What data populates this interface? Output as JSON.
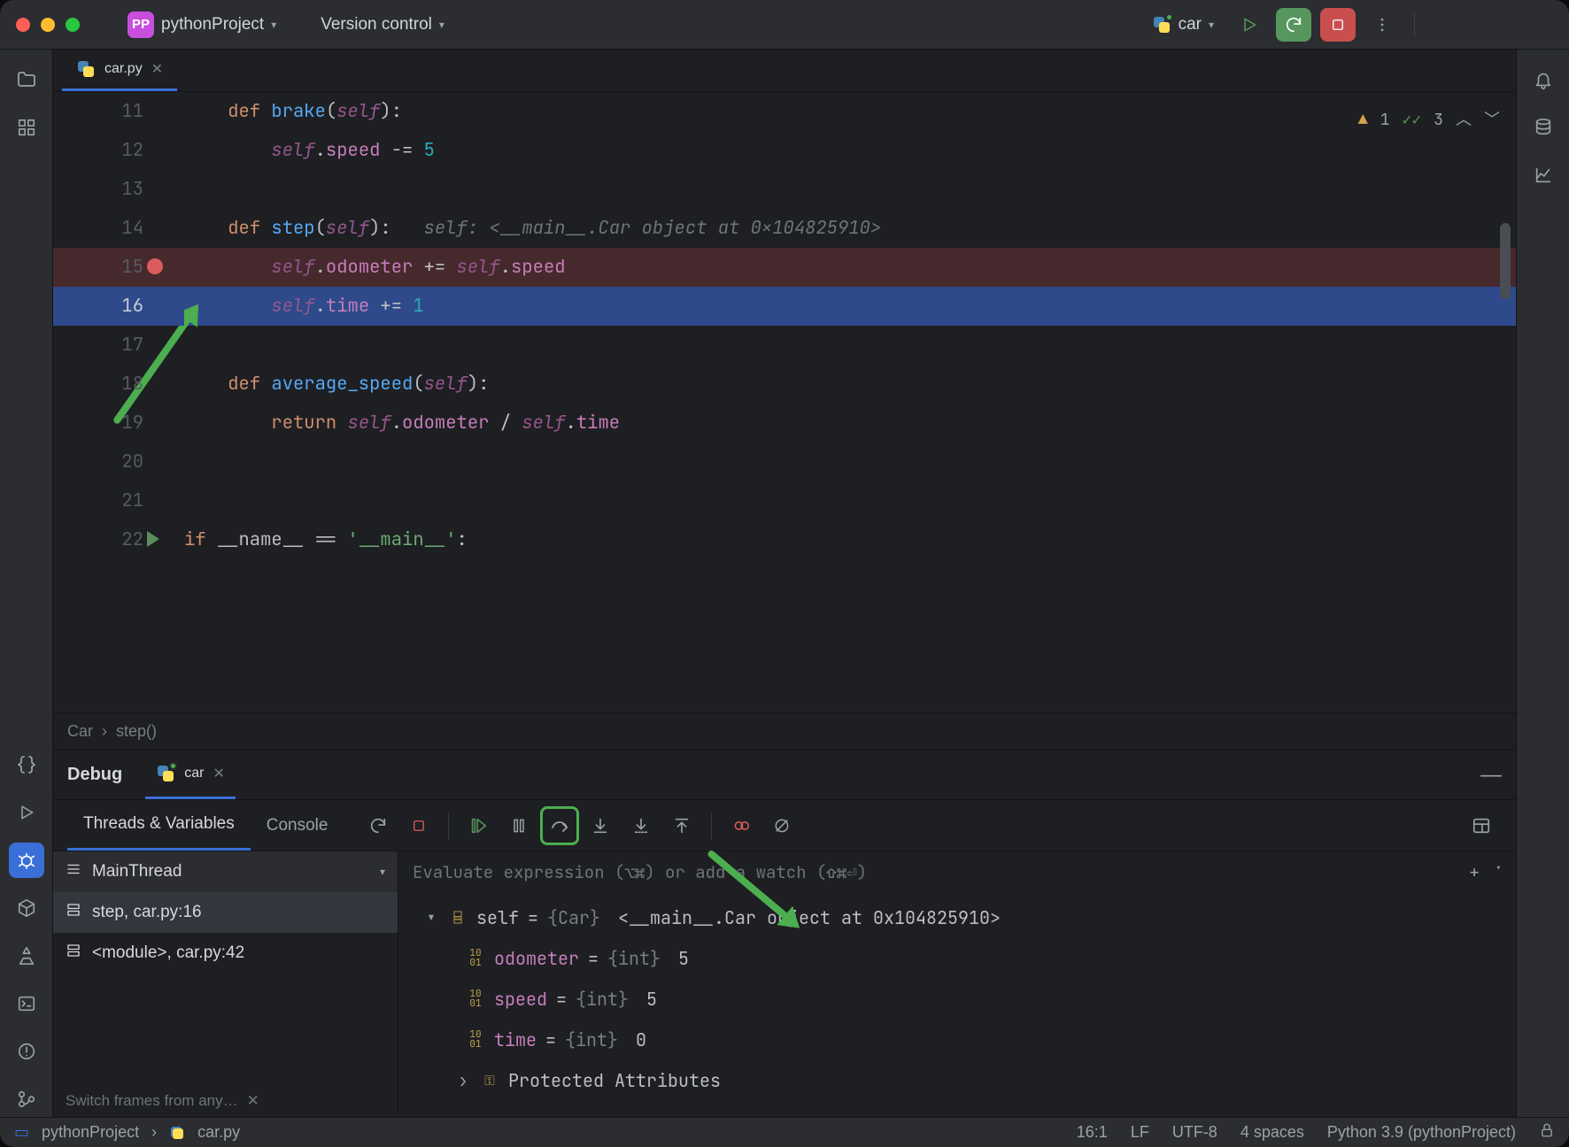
{
  "titlebar": {
    "project_badge": "PP",
    "project_name": "pythonProject",
    "vcs_menu": "Version control",
    "run_config_name": "car"
  },
  "editor_tab": {
    "filename": "car.py"
  },
  "inspection": {
    "warning_count": "1",
    "ok_count": "3"
  },
  "code_lines": [
    {
      "n": "11",
      "tokens": [
        {
          "t": "    ",
          "c": ""
        },
        {
          "t": "def ",
          "c": "k-kw"
        },
        {
          "t": "brake",
          "c": "k-fn"
        },
        {
          "t": "(",
          "c": ""
        },
        {
          "t": "self",
          "c": "k-self"
        },
        {
          "t": "):",
          "c": ""
        }
      ]
    },
    {
      "n": "12",
      "tokens": [
        {
          "t": "        ",
          "c": ""
        },
        {
          "t": "self",
          "c": "k-self"
        },
        {
          "t": ".",
          "c": ""
        },
        {
          "t": "speed",
          "c": "k-attr"
        },
        {
          "t": " -= ",
          "c": ""
        },
        {
          "t": "5",
          "c": "k-num"
        }
      ]
    },
    {
      "n": "13",
      "tokens": []
    },
    {
      "n": "14",
      "tokens": [
        {
          "t": "    ",
          "c": ""
        },
        {
          "t": "def ",
          "c": "k-kw"
        },
        {
          "t": "step",
          "c": "k-fn"
        },
        {
          "t": "(",
          "c": ""
        },
        {
          "t": "self",
          "c": "k-self"
        },
        {
          "t": "):   ",
          "c": ""
        },
        {
          "t": "self: <__main__.Car object at 0x104825910>",
          "c": "k-hint"
        }
      ]
    },
    {
      "n": "15",
      "bp": true,
      "tokens": [
        {
          "t": "        ",
          "c": ""
        },
        {
          "t": "self",
          "c": "k-self"
        },
        {
          "t": ".",
          "c": ""
        },
        {
          "t": "odometer",
          "c": "k-attr"
        },
        {
          "t": " += ",
          "c": ""
        },
        {
          "t": "self",
          "c": "k-self"
        },
        {
          "t": ".",
          "c": ""
        },
        {
          "t": "speed",
          "c": "k-attr"
        }
      ]
    },
    {
      "n": "16",
      "current": true,
      "tokens": [
        {
          "t": "        ",
          "c": ""
        },
        {
          "t": "self",
          "c": "k-self"
        },
        {
          "t": ".",
          "c": ""
        },
        {
          "t": "time",
          "c": "k-attr"
        },
        {
          "t": " += ",
          "c": ""
        },
        {
          "t": "1",
          "c": "k-num"
        }
      ]
    },
    {
      "n": "17",
      "tokens": []
    },
    {
      "n": "18",
      "tokens": [
        {
          "t": "    ",
          "c": ""
        },
        {
          "t": "def ",
          "c": "k-kw"
        },
        {
          "t": "average_speed",
          "c": "k-fn"
        },
        {
          "t": "(",
          "c": ""
        },
        {
          "t": "self",
          "c": "k-self"
        },
        {
          "t": "):",
          "c": ""
        }
      ]
    },
    {
      "n": "19",
      "tokens": [
        {
          "t": "        ",
          "c": ""
        },
        {
          "t": "return ",
          "c": "k-kw"
        },
        {
          "t": "self",
          "c": "k-self"
        },
        {
          "t": ".",
          "c": ""
        },
        {
          "t": "odometer",
          "c": "k-attr"
        },
        {
          "t": " / ",
          "c": ""
        },
        {
          "t": "self",
          "c": "k-self"
        },
        {
          "t": ".",
          "c": ""
        },
        {
          "t": "time",
          "c": "k-attr"
        }
      ]
    },
    {
      "n": "20",
      "tokens": []
    },
    {
      "n": "21",
      "tokens": []
    },
    {
      "n": "22",
      "play": true,
      "tokens": [
        {
          "t": "if ",
          "c": "k-kw"
        },
        {
          "t": "__name__ == ",
          "c": ""
        },
        {
          "t": "'__main__'",
          "c": "k-str"
        },
        {
          "t": ":",
          "c": ""
        }
      ]
    }
  ],
  "breadcrumb": {
    "cls": "Car",
    "fn": "step()"
  },
  "debug": {
    "title": "Debug",
    "session_name": "car",
    "tabs": {
      "threads": "Threads & Variables",
      "console": "Console"
    },
    "thread_selector": "MainThread",
    "frames": [
      {
        "label": "step, car.py:16",
        "selected": true
      },
      {
        "label": "<module>, car.py:42",
        "selected": false
      }
    ],
    "frames_hint": "Switch frames from any…",
    "eval_placeholder": "Evaluate expression (⌥⌘) or add a watch (⇧⌘⏎)",
    "variables": {
      "self_name": "self",
      "self_type": "{Car}",
      "self_repr": "<__main__.Car object at 0x104825910>",
      "fields": [
        {
          "name": "odometer",
          "type": "{int}",
          "value": "5"
        },
        {
          "name": "speed",
          "type": "{int}",
          "value": "5"
        },
        {
          "name": "time",
          "type": "{int}",
          "value": "0"
        }
      ],
      "protected_label": "Protected Attributes"
    }
  },
  "statusbar": {
    "project": "pythonProject",
    "file": "car.py",
    "pos": "16:1",
    "eol": "LF",
    "encoding": "UTF-8",
    "indent": "4 spaces",
    "interpreter": "Python 3.9 (pythonProject)"
  }
}
